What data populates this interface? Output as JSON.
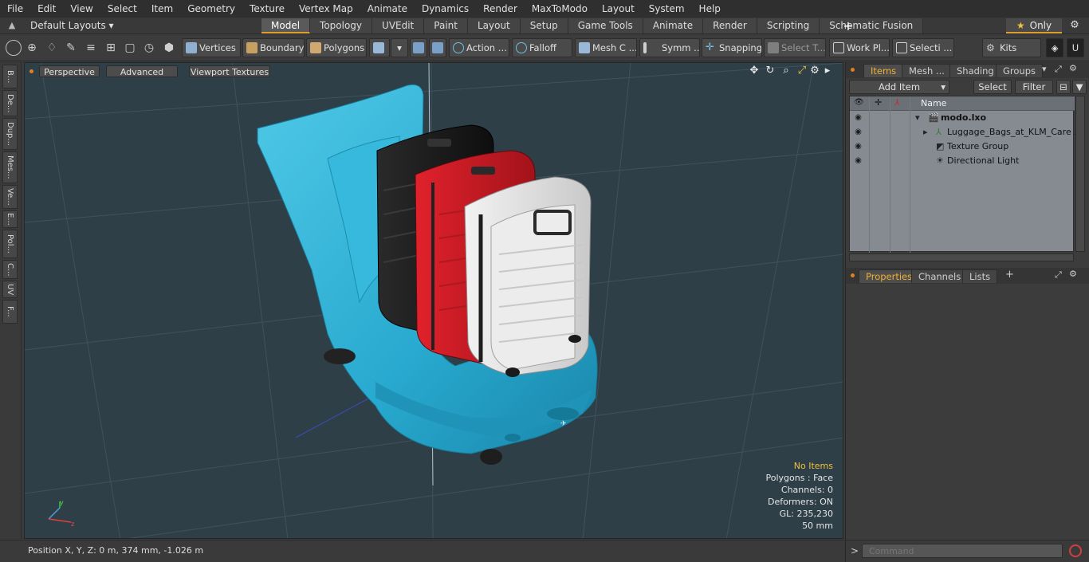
{
  "menu": [
    "File",
    "Edit",
    "View",
    "Select",
    "Item",
    "Geometry",
    "Texture",
    "Vertex Map",
    "Animate",
    "Dynamics",
    "Render",
    "MaxToModo",
    "Layout",
    "System",
    "Help"
  ],
  "layouts": {
    "selector": "Default Layouts",
    "tabs": [
      "Model",
      "Topology",
      "UVEdit",
      "Paint",
      "Layout",
      "Setup",
      "Game Tools",
      "Animate",
      "Render",
      "Scripting",
      "Schematic Fusion"
    ],
    "active_tab": "Model",
    "only_label": "Only"
  },
  "toolbar": {
    "vertices": "Vertices",
    "boundary": "Boundary",
    "polygons": "Polygons",
    "action": "Action",
    "falloff": "Falloff",
    "mesh": "Mesh C ...",
    "symm": "Symm ...",
    "snapping": "Snapping",
    "select_t": "Select T...",
    "work_pl": "Work Pl...",
    "selecti": "Selecti ...",
    "kits": "Kits"
  },
  "left_tabs": [
    "B...",
    "De...",
    "Dup...",
    "Mes...",
    "Ve...",
    "E...",
    "Pol...",
    "C...",
    "UV",
    "F..."
  ],
  "viewport": {
    "perspective": "Perspective",
    "advanced": "Advanced",
    "viewport_textures": "Viewport Textures",
    "stats": {
      "no_items": "No Items",
      "polygons": "Polygons : Face",
      "channels": "Channels: 0",
      "deformers": "Deformers: ON",
      "gl": "GL: 235,230",
      "scale": "50 mm"
    }
  },
  "status": {
    "position": "Position X, Y, Z:   0 m, 374 mm, -1.026 m"
  },
  "items_panel": {
    "tabs": [
      "Items",
      "Mesh ...",
      "Shading",
      "Groups"
    ],
    "active_tab": "Items",
    "add_item": "Add Item",
    "select": "Select",
    "filter": "Filter",
    "name_header": "Name",
    "rows": [
      {
        "label": "modo.lxo"
      },
      {
        "label": "Luggage_Bags_at_KLM_Care ..."
      },
      {
        "label": "Texture Group"
      },
      {
        "label": "Directional Light"
      }
    ]
  },
  "props_panel": {
    "tabs": [
      "Properties",
      "Channels",
      "Lists"
    ],
    "active_tab": "Properties"
  },
  "command": {
    "placeholder": "Command"
  },
  "colors": {
    "accent": "#e0a030",
    "viewport_bg": "#2f3f48",
    "cart_blue": "#2fb4d6",
    "case_black": "#1a1a1a",
    "case_red": "#d01a24",
    "case_white": "#e8e8e8"
  }
}
